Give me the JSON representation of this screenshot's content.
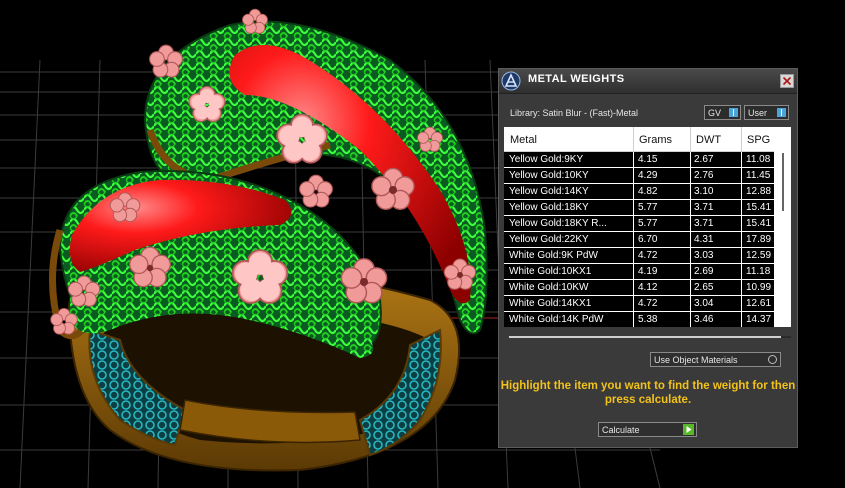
{
  "panel": {
    "title": "METAL WEIGHTS",
    "library": "Library: Satin Blur - (Fast)-Metal",
    "toggles": {
      "gv_label": "GV",
      "user_label": "User"
    },
    "table": {
      "headers": [
        "Metal",
        "Grams",
        "DWT",
        "SPG"
      ],
      "rows": [
        {
          "metal": "Yellow Gold:9KY",
          "grams": "4.15",
          "dwt": "2.67",
          "spg": "11.08"
        },
        {
          "metal": "Yellow Gold:10KY",
          "grams": "4.29",
          "dwt": "2.76",
          "spg": "11.45"
        },
        {
          "metal": "Yellow Gold:14KY",
          "grams": "4.82",
          "dwt": "3.10",
          "spg": "12.88"
        },
        {
          "metal": "Yellow Gold:18KY",
          "grams": "5.77",
          "dwt": "3.71",
          "spg": "15.41"
        },
        {
          "metal": "Yellow Gold:18KY R...",
          "grams": "5.77",
          "dwt": "3.71",
          "spg": "15.41"
        },
        {
          "metal": "Yellow Gold:22KY",
          "grams": "6.70",
          "dwt": "4.31",
          "spg": "17.89"
        },
        {
          "metal": "White Gold:9K PdW",
          "grams": "4.72",
          "dwt": "3.03",
          "spg": "12.59"
        },
        {
          "metal": "White Gold:10KX1",
          "grams": "4.19",
          "dwt": "2.69",
          "spg": "11.18"
        },
        {
          "metal": "White Gold:10KW",
          "grams": "4.12",
          "dwt": "2.65",
          "spg": "10.99"
        },
        {
          "metal": "White Gold:14KX1",
          "grams": "4.72",
          "dwt": "3.04",
          "spg": "12.61"
        },
        {
          "metal": "White Gold:14K PdW",
          "grams": "5.38",
          "dwt": "3.46",
          "spg": "14.37"
        }
      ]
    },
    "use_object_materials": "Use Object Materials",
    "instruction": "Highlight the item you want to find the weight for then press calculate.",
    "calculate_label": "Calculate"
  },
  "colors": {
    "accent": "#f1c21b",
    "panel_bg": "#3a3a3a",
    "toggle_on": "#4aa6d8",
    "calculate_arrow": "#59b82a"
  },
  "icons": {
    "app": "metal-weights-app-icon",
    "close": "close-icon",
    "calculate": "play-arrow-icon"
  }
}
